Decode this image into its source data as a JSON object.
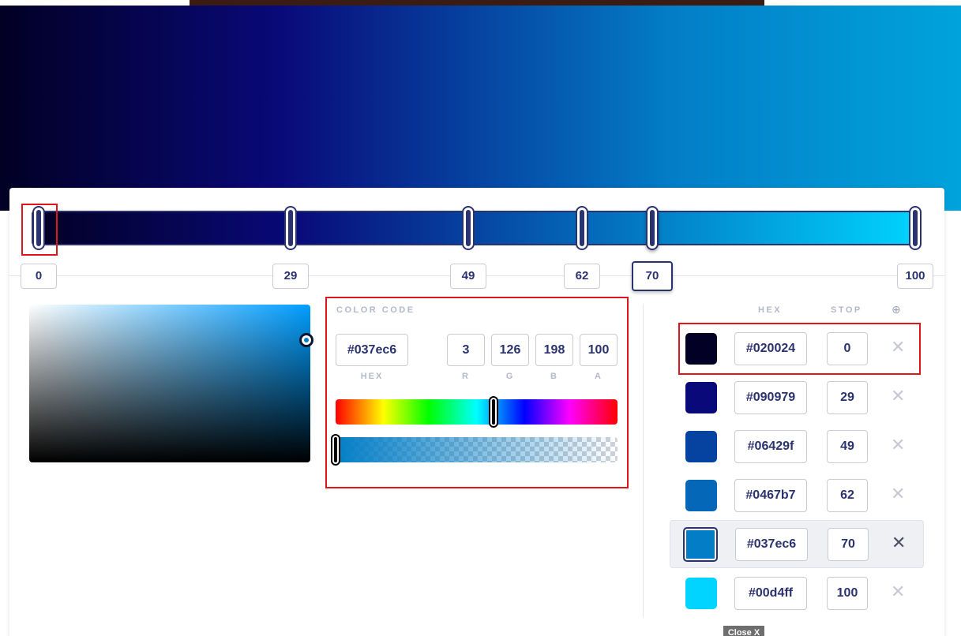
{
  "gradient": {
    "stops": [
      {
        "hex": "#020024",
        "stop": "0"
      },
      {
        "hex": "#090979",
        "stop": "29"
      },
      {
        "hex": "#06429f",
        "stop": "49"
      },
      {
        "hex": "#0467b7",
        "stop": "62"
      },
      {
        "hex": "#037ec6",
        "stop": "70"
      },
      {
        "hex": "#00d4ff",
        "stop": "100"
      }
    ],
    "active_stop": 4
  },
  "picker": {
    "section_title": "COLOR CODE",
    "hex": "#037ec6",
    "r": "3",
    "g": "126",
    "b": "198",
    "a": "100",
    "hex_label": "HEX",
    "r_label": "R",
    "g_label": "G",
    "b_label": "B",
    "a_label": "A",
    "hue_level": 0.56,
    "alpha_level": 1.0
  },
  "stops_list": {
    "hex_header": "HEX",
    "stop_header": "STOP",
    "add_icon": "⊕",
    "remove_icon": "✕"
  },
  "footer": {
    "close_label": "Close X"
  },
  "colors": {
    "accent": "#2b3270",
    "highlight": "#e0141b"
  }
}
